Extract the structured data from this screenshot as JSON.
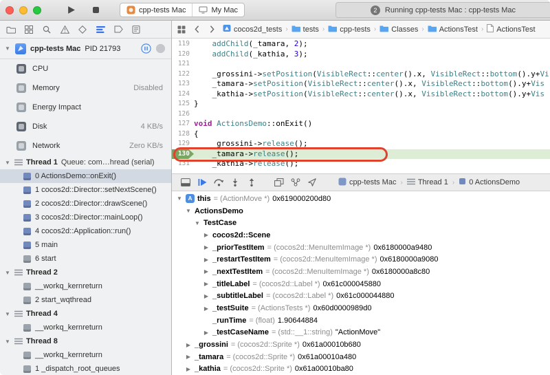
{
  "toolbar": {
    "scheme": {
      "name": "cpp-tests Mac",
      "destination": "My Mac"
    },
    "activity": {
      "badge_count": "2",
      "message": "Running cpp-tests Mac : cpp-tests Mac"
    }
  },
  "navigator": {
    "bar_icons": [
      {
        "name": "project-navigator-icon",
        "glyph": "folder"
      },
      {
        "name": "symbol-navigator-icon",
        "glyph": "grid"
      },
      {
        "name": "find-navigator-icon",
        "glyph": "search"
      },
      {
        "name": "issue-navigator-icon",
        "glyph": "warning"
      },
      {
        "name": "test-navigator-icon",
        "glyph": "diamond"
      },
      {
        "name": "debug-navigator-icon",
        "glyph": "debug",
        "selected": true
      },
      {
        "name": "breakpoint-navigator-icon",
        "glyph": "breakpoint"
      },
      {
        "name": "report-navigator-icon",
        "glyph": "report"
      }
    ],
    "process_row": {
      "name": "cpp-tests Mac",
      "pid": "PID 21793"
    },
    "gauges": [
      {
        "label": "CPU",
        "value": "",
        "tone": "dark"
      },
      {
        "label": "Memory",
        "value": "Disabled",
        "tone": "light"
      },
      {
        "label": "Energy Impact",
        "value": "",
        "tone": "light"
      },
      {
        "label": "Disk",
        "value": "4 KB/s",
        "tone": "dark"
      },
      {
        "label": "Network",
        "value": "Zero KB/s",
        "tone": "light"
      }
    ],
    "threads": [
      {
        "label": "Thread 1",
        "detail": "Queue: com…hread (serial)",
        "frames": [
          {
            "text": "0 ActionsDemo::onExit()",
            "tone": "blue",
            "selected": true
          },
          {
            "text": "1 cocos2d::Director::setNextScene()",
            "tone": "blue"
          },
          {
            "text": "2 cocos2d::Director::drawScene()",
            "tone": "blue"
          },
          {
            "text": "3 cocos2d::Director::mainLoop()",
            "tone": "blue"
          },
          {
            "text": "4 cocos2d::Application::run()",
            "tone": "blue"
          },
          {
            "text": "5 main",
            "tone": "blue"
          },
          {
            "text": "6 start",
            "tone": "gray"
          }
        ]
      },
      {
        "label": "Thread 2",
        "detail": "",
        "frames": [
          {
            "text": "__workq_kernreturn",
            "tone": "gray"
          },
          {
            "text": "2 start_wqthread",
            "tone": "gray"
          }
        ]
      },
      {
        "label": "Thread 4",
        "detail": "",
        "frames": [
          {
            "text": "__workq_kernreturn",
            "tone": "gray"
          }
        ]
      },
      {
        "label": "Thread 8",
        "detail": "",
        "frames": [
          {
            "text": "__workq_kernreturn",
            "tone": "gray"
          },
          {
            "text": "1 _dispatch_root_queues",
            "tone": "gray"
          }
        ]
      }
    ]
  },
  "editor": {
    "jump_bar": {
      "crumbs": [
        {
          "label": "cocos2d_tests",
          "icon": "project"
        },
        {
          "label": "tests",
          "icon": "folder"
        },
        {
          "label": "cpp-tests",
          "icon": "folder"
        },
        {
          "label": "Classes",
          "icon": "folder"
        },
        {
          "label": "ActionsTest",
          "icon": "folder"
        },
        {
          "label": "ActionsTest",
          "icon": "file"
        }
      ]
    },
    "code_lines": [
      {
        "num": 119,
        "segments": [
          {
            "t": "    ",
            "c": "p"
          },
          {
            "t": "addChild",
            "c": "t"
          },
          {
            "t": "(_tamara, ",
            "c": "p"
          },
          {
            "t": "2",
            "c": "n"
          },
          {
            "t": ");",
            "c": "p"
          }
        ]
      },
      {
        "num": 120,
        "segments": [
          {
            "t": "    ",
            "c": "p"
          },
          {
            "t": "addChild",
            "c": "t"
          },
          {
            "t": "(_kathia, ",
            "c": "p"
          },
          {
            "t": "3",
            "c": "n"
          },
          {
            "t": ");",
            "c": "p"
          }
        ]
      },
      {
        "num": 121,
        "segments": []
      },
      {
        "num": 122,
        "segments": [
          {
            "t": "    ",
            "c": "p"
          },
          {
            "t": "_grossini->",
            "c": "p"
          },
          {
            "t": "setPosition",
            "c": "t"
          },
          {
            "t": "(",
            "c": "p"
          },
          {
            "t": "VisibleRect",
            "c": "t"
          },
          {
            "t": "::",
            "c": "p"
          },
          {
            "t": "center",
            "c": "t"
          },
          {
            "t": "().x, ",
            "c": "p"
          },
          {
            "t": "VisibleRect",
            "c": "t"
          },
          {
            "t": "::",
            "c": "p"
          },
          {
            "t": "bottom",
            "c": "t"
          },
          {
            "t": "().y+",
            "c": "p"
          },
          {
            "t": "Vi",
            "c": "t"
          }
        ]
      },
      {
        "num": 123,
        "segments": [
          {
            "t": "    ",
            "c": "p"
          },
          {
            "t": "_tamara->",
            "c": "p"
          },
          {
            "t": "setPosition",
            "c": "t"
          },
          {
            "t": "(",
            "c": "p"
          },
          {
            "t": "VisibleRect",
            "c": "t"
          },
          {
            "t": "::",
            "c": "p"
          },
          {
            "t": "center",
            "c": "t"
          },
          {
            "t": "().x, ",
            "c": "p"
          },
          {
            "t": "VisibleRect",
            "c": "t"
          },
          {
            "t": "::",
            "c": "p"
          },
          {
            "t": "bottom",
            "c": "t"
          },
          {
            "t": "().y+",
            "c": "p"
          },
          {
            "t": "Vis",
            "c": "t"
          }
        ]
      },
      {
        "num": 124,
        "segments": [
          {
            "t": "    ",
            "c": "p"
          },
          {
            "t": "_kathia->",
            "c": "p"
          },
          {
            "t": "setPosition",
            "c": "t"
          },
          {
            "t": "(",
            "c": "p"
          },
          {
            "t": "VisibleRect",
            "c": "t"
          },
          {
            "t": "::",
            "c": "p"
          },
          {
            "t": "center",
            "c": "t"
          },
          {
            "t": "().x, ",
            "c": "p"
          },
          {
            "t": "VisibleRect",
            "c": "t"
          },
          {
            "t": "::",
            "c": "p"
          },
          {
            "t": "bottom",
            "c": "t"
          },
          {
            "t": "().y+",
            "c": "p"
          },
          {
            "t": "Vis",
            "c": "t"
          }
        ]
      },
      {
        "num": 125,
        "segments": [
          {
            "t": "}",
            "c": "p"
          }
        ]
      },
      {
        "num": 126,
        "segments": []
      },
      {
        "num": 127,
        "segments": [
          {
            "t": "void",
            "c": "k"
          },
          {
            "t": " ",
            "c": "p"
          },
          {
            "t": "ActionsDemo",
            "c": "t"
          },
          {
            "t": "::onExit()",
            "c": "p"
          }
        ]
      },
      {
        "num": 128,
        "segments": [
          {
            "t": "{",
            "c": "p"
          }
        ]
      },
      {
        "num": 129,
        "segments": [
          {
            "t": "    ",
            "c": "p"
          },
          {
            "t": "_grossini->",
            "c": "p"
          },
          {
            "t": "release",
            "c": "t"
          },
          {
            "t": "();",
            "c": "p"
          }
        ]
      },
      {
        "num": 130,
        "current": true,
        "segments": [
          {
            "t": "    ",
            "c": "p"
          },
          {
            "t": "_tamara->",
            "c": "p"
          },
          {
            "t": "release",
            "c": "t"
          },
          {
            "t": "();",
            "c": "p"
          }
        ]
      },
      {
        "num": 131,
        "segments": [
          {
            "t": "    ",
            "c": "p"
          },
          {
            "t": "_kathia->",
            "c": "p"
          },
          {
            "t": "release",
            "c": "t"
          },
          {
            "t": "();",
            "c": "p"
          }
        ]
      }
    ]
  },
  "debug_bar": {
    "buttons": [
      {
        "name": "hide-debug-area-button",
        "glyph": "debugarea"
      },
      {
        "name": "continue-button",
        "glyph": "continue",
        "accent": true
      },
      {
        "name": "step-over-button",
        "glyph": "stepover"
      },
      {
        "name": "step-into-button",
        "glyph": "stepinto"
      },
      {
        "name": "step-out-button",
        "glyph": "stepout"
      },
      {
        "name": "view-hierarchy-button",
        "glyph": "hierarchy",
        "gap": true
      },
      {
        "name": "memory-graph-button",
        "glyph": "memory"
      },
      {
        "name": "simulate-location-button",
        "glyph": "location"
      }
    ],
    "breadcrumb": [
      {
        "label": "cpp-tests Mac",
        "icon": "app"
      },
      {
        "label": "Thread 1",
        "icon": "thread"
      },
      {
        "label": "0 ActionsDemo",
        "icon": "frame"
      }
    ]
  },
  "variables": {
    "rows": [
      {
        "indent": 0,
        "disclosure": "open",
        "icon": "A",
        "name": "this",
        "type": "= (ActionMove *) ",
        "value": "0x619000200d80"
      },
      {
        "indent": 1,
        "disclosure": "open",
        "name": "ActionsDemo"
      },
      {
        "indent": 2,
        "disclosure": "open",
        "name": "TestCase"
      },
      {
        "indent": 3,
        "disclosure": "closed",
        "name": "cocos2d::Scene"
      },
      {
        "indent": 3,
        "disclosure": "closed",
        "name": "_priorTestItem",
        "type": "= (cocos2d::MenuItemImage *) ",
        "value": "0x6180000a9480"
      },
      {
        "indent": 3,
        "disclosure": "closed",
        "name": "_restartTestItem",
        "type": "= (cocos2d::MenuItemImage *) ",
        "value": "0x6180000a9080"
      },
      {
        "indent": 3,
        "disclosure": "closed",
        "name": "_nextTestItem",
        "type": "= (cocos2d::MenuItemImage *) ",
        "value": "0x6180000a8c80"
      },
      {
        "indent": 3,
        "disclosure": "closed",
        "name": "_titleLabel",
        "type": "= (cocos2d::Label *) ",
        "value": "0x61c000045880"
      },
      {
        "indent": 3,
        "disclosure": "closed",
        "name": "_subtitleLabel",
        "type": "= (cocos2d::Label *) ",
        "value": "0x61c000044880"
      },
      {
        "indent": 3,
        "disclosure": "closed",
        "name": "_testSuite",
        "type": "= (ActionsTests *) ",
        "value": "0x60d0000989d0"
      },
      {
        "indent": 3,
        "disclosure": "none",
        "name": "_runTime",
        "type": "= (float) ",
        "value": "1.90644884"
      },
      {
        "indent": 3,
        "disclosure": "closed",
        "name": "_testCaseName",
        "type": "= (std::__1::string) ",
        "value": "\"ActionMove\""
      },
      {
        "indent": 1,
        "disclosure": "closed",
        "name": "_grossini",
        "type": "= (cocos2d::Sprite *) ",
        "value": "0x61a00010b680"
      },
      {
        "indent": 1,
        "disclosure": "closed",
        "name": "_tamara",
        "type": "= (cocos2d::Sprite *) ",
        "value": "0x61a00010a480"
      },
      {
        "indent": 1,
        "disclosure": "closed",
        "name": "_kathia",
        "type": "= (cocos2d::Sprite *) ",
        "value": "0x61a00010ba80"
      }
    ]
  },
  "colors": {
    "keyword": "#9b2393",
    "type_function": "#3e8087",
    "number": "#1c00cf",
    "current_line_bg": "#dcecd5",
    "current_line_gutter": "#79a662",
    "annotation": "#e0432d",
    "selected_frame_bg": "#d2d9e3",
    "navigator_accent": "#3a76e8"
  }
}
